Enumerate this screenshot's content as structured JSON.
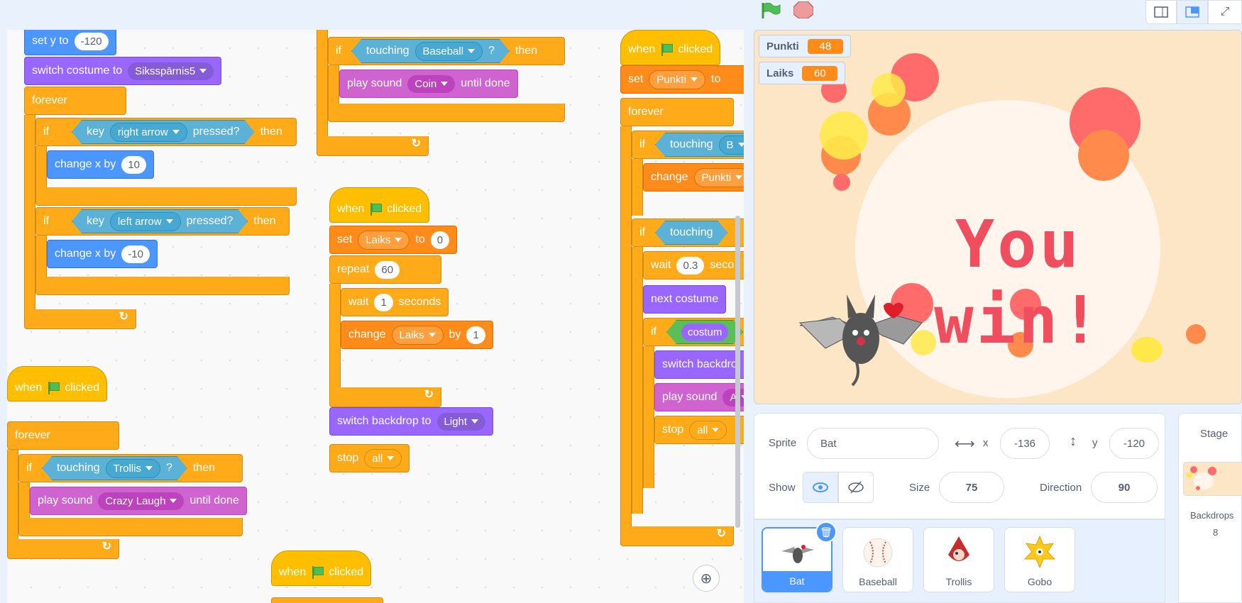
{
  "topbar": {
    "green_flag": "green-flag-icon",
    "stop": "stop-icon"
  },
  "blocks": {
    "set_y": {
      "label": "set y to",
      "value": "-120"
    },
    "switch_costume": {
      "label": "switch costume to",
      "value": "Siksspārnis5"
    },
    "forever": "forever",
    "if": "if",
    "then": "then",
    "key": "key",
    "pressed": "pressed?",
    "right_arrow": "right arrow",
    "left_arrow": "left arrow",
    "change_x": "change x by",
    "change_x_val1": "10",
    "change_x_val2": "-10",
    "when": "when",
    "clicked": "clicked",
    "touching": "touching",
    "qmark": "?",
    "trollis": "Trollis",
    "baseball": "Baseball",
    "play_sound": "play sound",
    "until_done": "until done",
    "crazy_laugh": "Crazy Laugh",
    "coin": "Coin",
    "set": "set",
    "to": "to",
    "laiks": "Laiks",
    "punkti": "Punkti",
    "zero": "0",
    "repeat": "repeat",
    "repeat_val": "60",
    "wait": "wait",
    "seconds": "seconds",
    "wait_val": "1",
    "wait_val2": "0.3",
    "secon_trunc": "seco",
    "change": "change",
    "by": "by",
    "change_val": "1",
    "switch_backdrop": "switch backdrop to",
    "switch_backdrop_trunc": "switch backdro",
    "light": "Light",
    "stop": "stop",
    "all": "all",
    "next_costume": "next costume",
    "costume_trunc": "costum",
    "touching_b_trunc": "B",
    "play_sound_a_trunc": "A"
  },
  "stage": {
    "monitors": [
      {
        "label": "Punkti",
        "value": "48"
      },
      {
        "label": "Laiks",
        "value": "60"
      }
    ],
    "win_text": "You win!"
  },
  "sprite_info": {
    "sprite_label": "Sprite",
    "sprite_name": "Bat",
    "x_label": "x",
    "x_value": "-136",
    "y_label": "y",
    "y_value": "-120",
    "show_label": "Show",
    "size_label": "Size",
    "size_value": "75",
    "direction_label": "Direction",
    "direction_value": "90"
  },
  "sprites": [
    {
      "name": "Bat",
      "selected": true
    },
    {
      "name": "Baseball",
      "selected": false
    },
    {
      "name": "Trollis",
      "selected": false
    },
    {
      "name": "Gobo",
      "selected": false
    }
  ],
  "stage_panel": {
    "title": "Stage",
    "backdrops_label": "Backdrops",
    "backdrops_count": "8"
  }
}
